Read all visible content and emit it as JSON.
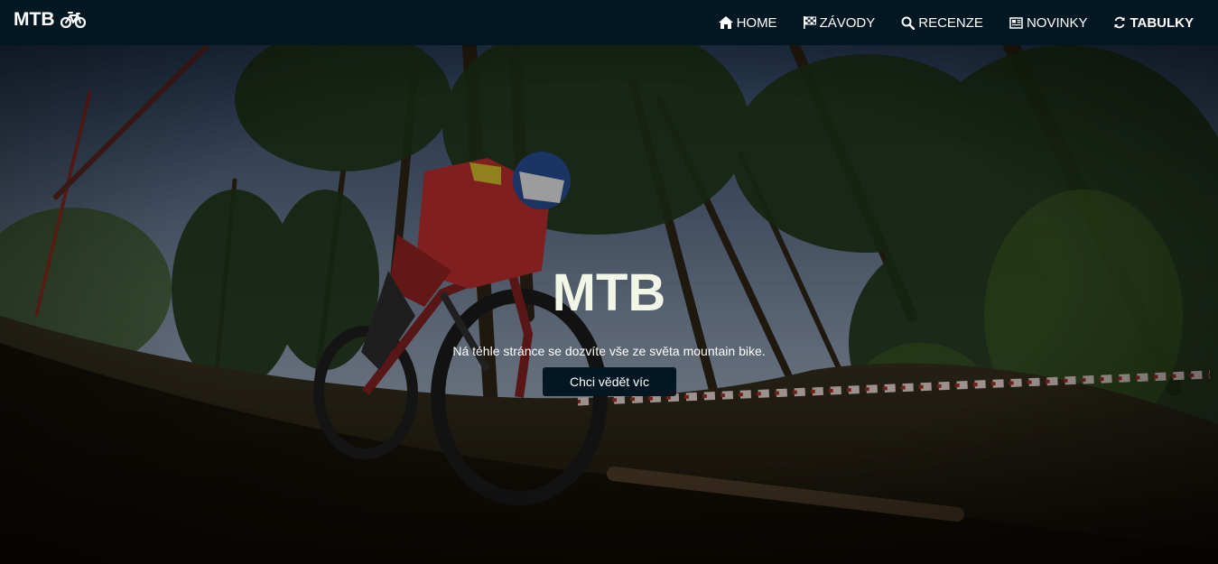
{
  "brand": {
    "name": "MTB",
    "icon": "bicycle-icon"
  },
  "nav": {
    "items": [
      {
        "label": "HOME",
        "icon": "home-icon"
      },
      {
        "label": "ZÁVODY",
        "icon": "flag-checkered-icon"
      },
      {
        "label": "RECENZE",
        "icon": "search-icon"
      },
      {
        "label": "NOVINKY",
        "icon": "newspaper-icon"
      },
      {
        "label": "TABULKY",
        "icon": "refresh-icon"
      }
    ]
  },
  "hero": {
    "title": "MTB",
    "subtitle": "Ná téhle stránce se dozvíte vše ze světa mountain bike.",
    "button_label": "Chci vědět víc",
    "image_subject": "downhill mountain biker in red jersey riding through pine forest"
  },
  "colors": {
    "navbar": "#031722",
    "button": "#031722",
    "title": "#f2f6e6",
    "text": "#ffffff"
  }
}
